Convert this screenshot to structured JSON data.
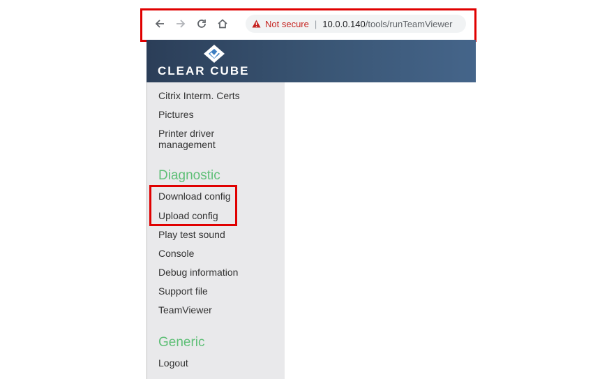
{
  "browser": {
    "security_label": "Not secure",
    "separator": "|",
    "url_host": "10.0.0.140",
    "url_path": "/tools/runTeamViewer"
  },
  "banner": {
    "logo_text": "CLEAR CUBE"
  },
  "sidebar": {
    "items_top": [
      "Citrix Interm. Certs",
      "Pictures",
      "Printer driver management"
    ],
    "section_diagnostic": "Diagnostic",
    "diagnostic_items": [
      "Download config",
      "Upload config",
      "Play test sound",
      "Console",
      "Debug information",
      "Support file",
      "TeamViewer"
    ],
    "section_generic": "Generic",
    "generic_items": [
      "Logout"
    ]
  },
  "colors": {
    "highlight": "#e00000",
    "section": "#5fbf77",
    "banner": "#3a5675"
  }
}
